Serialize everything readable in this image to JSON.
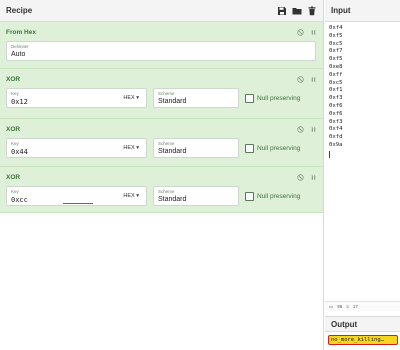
{
  "recipe": {
    "title": "Recipe",
    "icons": [
      "save-icon",
      "folder-icon",
      "trash-icon"
    ],
    "operations": [
      {
        "name": "From Hex",
        "delimiter_label": "Delimiter",
        "delimiter_value": "Auto"
      },
      {
        "name": "XOR",
        "key_label": "Key",
        "key_value": "0x12",
        "format": "HEX",
        "scheme_label": "Scheme",
        "scheme_value": "Standard",
        "null_label": "Null preserving"
      },
      {
        "name": "XOR",
        "key_label": "Key",
        "key_value": "0x44",
        "format": "HEX",
        "scheme_label": "Scheme",
        "scheme_value": "Standard",
        "null_label": "Null preserving"
      },
      {
        "name": "XOR",
        "key_label": "Key",
        "key_value": "0xcc",
        "format": "HEX",
        "scheme_label": "Scheme",
        "scheme_value": "Standard",
        "null_label": "Null preserving"
      }
    ]
  },
  "input": {
    "title": "Input",
    "lines": [
      "0xf4",
      "0xf5",
      "0xc5",
      "0xf7",
      "0xf5",
      "0xe8",
      "0xff",
      "0xc5",
      "0xf1",
      "0xf3",
      "0xf6",
      "0xf6",
      "0xf3",
      "0xf4",
      "0xfd",
      "0x9a"
    ],
    "stats": {
      "length": "96",
      "lines": "17"
    }
  },
  "output": {
    "title": "Output",
    "text": "no_more_killing…"
  },
  "colors": {
    "op_bg": "#dff0d8",
    "op_title": "#3c763d",
    "highlight": "#f7d51d",
    "highlight_border": "#d81e1e"
  }
}
